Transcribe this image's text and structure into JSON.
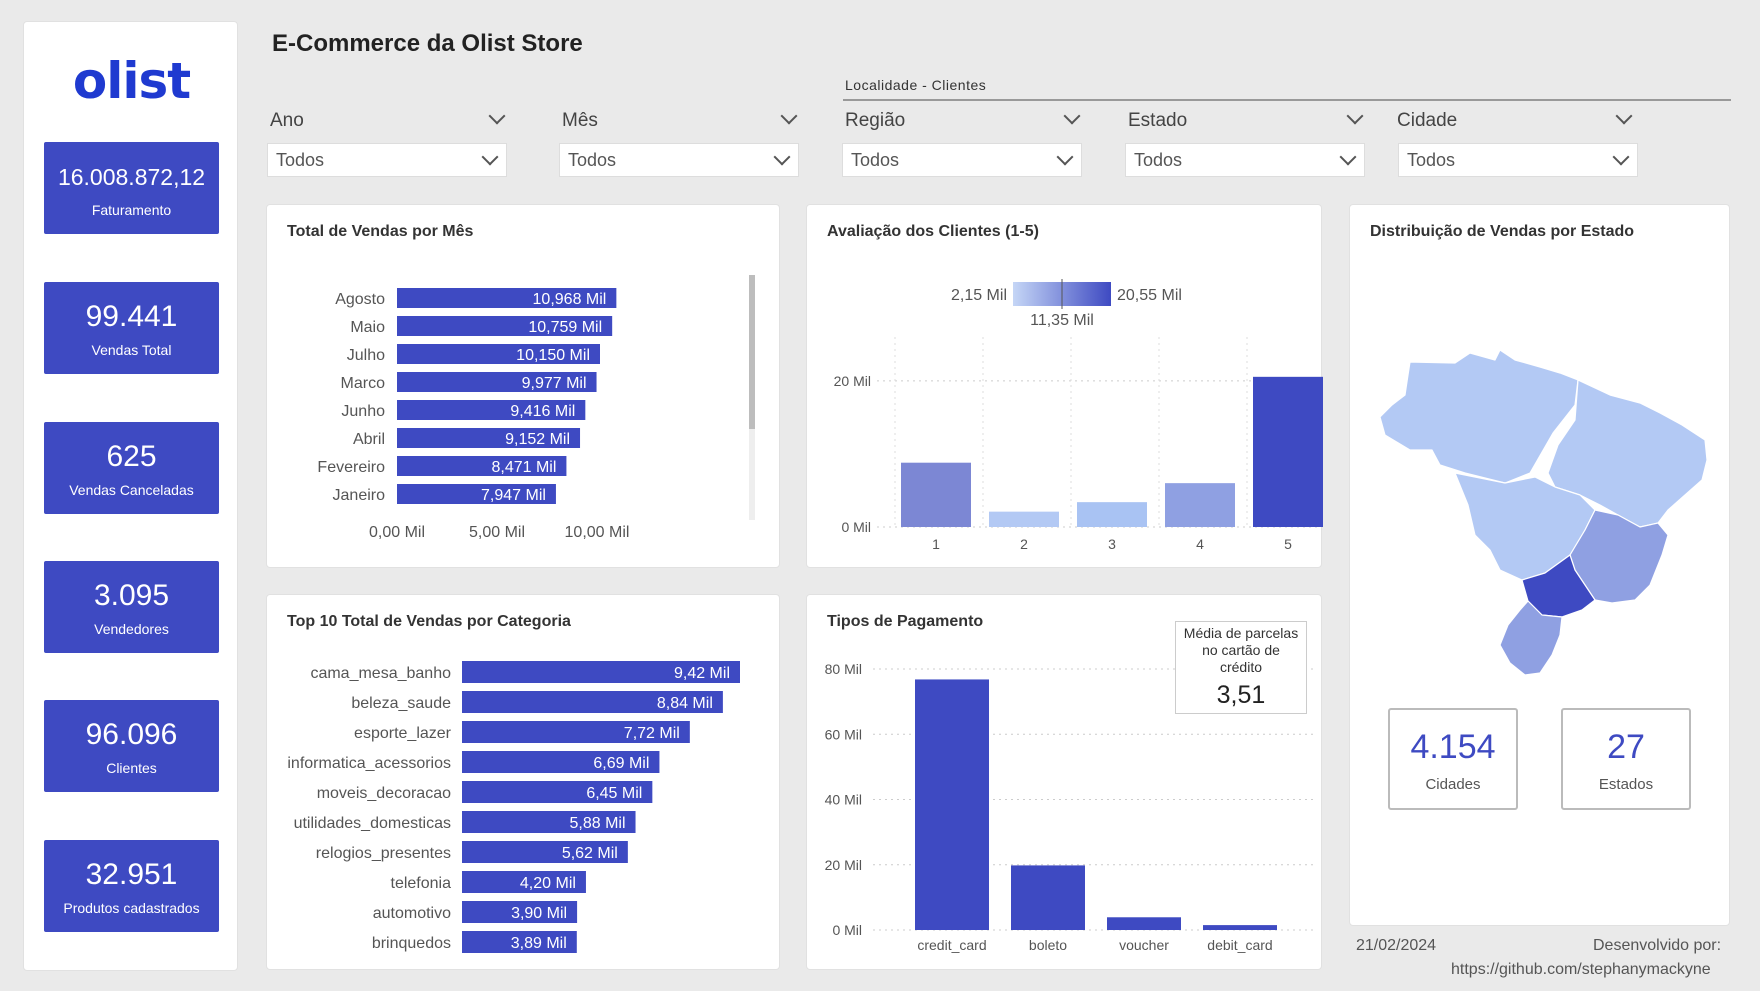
{
  "header": {
    "title": "E-Commerce da Olist Store",
    "logo_text": "olist"
  },
  "kpis": [
    {
      "value": "16.008.872,12",
      "label": "Faturamento"
    },
    {
      "value": "99.441",
      "label": "Vendas Total"
    },
    {
      "value": "625",
      "label": "Vendas Canceladas"
    },
    {
      "value": "3.095",
      "label": "Vendedores"
    },
    {
      "value": "96.096",
      "label": "Clientes"
    },
    {
      "value": "32.951",
      "label": "Produtos cadastrados"
    }
  ],
  "filters": {
    "group_title": "Localidade - Clientes",
    "slicers": [
      {
        "label": "Ano",
        "value": "Todos"
      },
      {
        "label": "Mês",
        "value": "Todos"
      },
      {
        "label": "Região",
        "value": "Todos"
      },
      {
        "label": "Estado",
        "value": "Todos"
      },
      {
        "label": "Cidade",
        "value": "Todos"
      }
    ]
  },
  "chart_data": [
    {
      "type": "bar",
      "orientation": "horizontal",
      "title": "Total de Vendas por Mês",
      "categories": [
        "Agosto",
        "Maio",
        "Julho",
        "Marco",
        "Junho",
        "Abril",
        "Fevereiro",
        "Janeiro"
      ],
      "values": [
        10968,
        10759,
        10150,
        9977,
        9416,
        9152,
        8471,
        7947
      ],
      "data_labels": [
        "10,968 Mil",
        "10,759 Mil",
        "10,150 Mil",
        "9,977 Mil",
        "9,416 Mil",
        "9,152 Mil",
        "8,471 Mil",
        "7,947 Mil"
      ],
      "xticks": [
        "0,00 Mil",
        "5,00 Mil",
        "10,00 Mil"
      ],
      "xlim": [
        0,
        11000
      ],
      "color": "#3e4ac2"
    },
    {
      "type": "bar",
      "title": "Avaliação dos Clientes (1-5)",
      "categories": [
        "1",
        "2",
        "3",
        "4",
        "5"
      ],
      "values": [
        8800,
        2100,
        3400,
        6000,
        20550
      ],
      "colors": [
        "#7c87d4",
        "#b3c9f4",
        "#a9c3f3",
        "#8fa0e2",
        "#3e4ac2"
      ],
      "ylim": [
        0,
        26000
      ],
      "yticks": [
        {
          "value": 0,
          "label": "0 Mil"
        },
        {
          "value": 20000,
          "label": "20 Mil"
        }
      ],
      "grid": true,
      "color_legend": {
        "min": "2,15 Mil",
        "mid": "11,35 Mil",
        "max": "20,55 Mil"
      }
    },
    {
      "type": "bar",
      "orientation": "horizontal",
      "title": "Top 10 Total de Vendas por Categoria",
      "categories": [
        "cama_mesa_banho",
        "beleza_saude",
        "esporte_lazer",
        "informatica_acessorios",
        "moveis_decoracao",
        "utilidades_domesticas",
        "relogios_presentes",
        "telefonia",
        "automotivo",
        "brinquedos"
      ],
      "values": [
        9420,
        8840,
        7720,
        6690,
        6450,
        5880,
        5620,
        4200,
        3900,
        3890
      ],
      "data_labels": [
        "9,42 Mil",
        "8,84 Mil",
        "7,72 Mil",
        "6,69 Mil",
        "6,45 Mil",
        "5,88 Mil",
        "5,62 Mil",
        "4,20 Mil",
        "3,90 Mil",
        "3,89 Mil"
      ],
      "xlim": [
        0,
        9420
      ],
      "color": "#3e4ac2"
    },
    {
      "type": "bar",
      "title": "Tipos de Pagamento",
      "categories": [
        "credit_card",
        "boleto",
        "voucher",
        "debit_card"
      ],
      "values": [
        76800,
        19800,
        3900,
        1500
      ],
      "ylim": [
        0,
        80000
      ],
      "yticks": [
        {
          "value": 0,
          "label": "0 Mil"
        },
        {
          "value": 20000,
          "label": "20 Mil"
        },
        {
          "value": 40000,
          "label": "40 Mil"
        },
        {
          "value": 60000,
          "label": "60 Mil"
        },
        {
          "value": 80000,
          "label": "80 Mil"
        }
      ],
      "grid": true,
      "color": "#3e4ac2"
    }
  ],
  "payment_card": {
    "label": "Média de parcelas no cartão de crédito",
    "value": "3,51"
  },
  "map": {
    "title": "Distribuição de Vendas por Estado",
    "cities": {
      "value": "4.154",
      "label": "Cidades"
    },
    "states": {
      "value": "27",
      "label": "Estados"
    },
    "colors": {
      "low": "#b3c9f4",
      "mid": "#8fa0e2",
      "high": "#3e4ac2"
    }
  },
  "footer": {
    "date": "21/02/2024",
    "developed_by": "Desenvolvido por:",
    "link": "https://github.com/stephanymackyne"
  }
}
